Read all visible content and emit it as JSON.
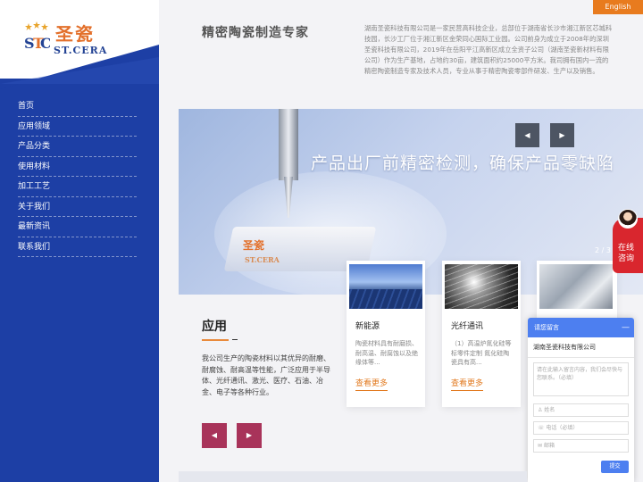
{
  "brand": {
    "name_cn": "圣瓷",
    "name_en": "ST.CERA",
    "mark": "STC"
  },
  "header": {
    "english_label": "English"
  },
  "nav": [
    {
      "label": "首页"
    },
    {
      "label": "应用领域"
    },
    {
      "label": "产品分类"
    },
    {
      "label": "使用材料"
    },
    {
      "label": "加工工艺"
    },
    {
      "label": "关于我们"
    },
    {
      "label": "最新资讯"
    },
    {
      "label": "联系我们"
    }
  ],
  "intro": {
    "title": "精密陶瓷制造专家",
    "text": "湖南圣瓷科技有限公司是一家民营高科技企业，总部位于湖南省长沙市湘江新区芯城科技园，长沙工厂位于湘江新区金荣同心国际工业园。公司前身为成立于2008年的深圳圣瓷科技有限公司，2019年在岳阳平江高新区成立全资子公司（湖南圣瓷新材料有限公司）作为生产基地，占地约30亩，建筑面积约25000平方米。我司拥有国内一流的精密陶瓷制造专家及技术人员，专业从事于精密陶瓷零部件研发、生产以及销售。"
  },
  "banner": {
    "slogan": "产品出厂前精密检测，确保产品零缺陷",
    "part_logo_cn": "圣瓷",
    "part_logo_en": "ST.CERA",
    "counter": "2 / 3",
    "prev_glyph": "◀",
    "next_glyph": "▶"
  },
  "application": {
    "title": "应用",
    "dash": "–",
    "desc": "我公司生产的陶瓷材料以其优异的耐磨、耐腐蚀、耐高温等性能，广泛应用于半导体、光纤通讯、激光、医疗、石油、冶金、电子等各种行业。",
    "prev_glyph": "◀",
    "next_glyph": "▶",
    "cards": [
      {
        "title": "新能源",
        "desc": "陶瓷材料具有耐磨损、耐高温、耐腐蚀以及绝缘体等...",
        "more": "查看更多"
      },
      {
        "title": "光纤通讯",
        "desc": "（1）高温炉氮化硅等标零件定制 氮化硅陶瓷具有高...",
        "more": "查看更多"
      }
    ]
  },
  "consult": {
    "label_line1": "在线",
    "label_line2": "咨询"
  },
  "message": {
    "header": "请您留言",
    "minimize": "—",
    "company": "湖南圣瓷科技有限公司",
    "content_placeholder": "请在此输入留言内容，我们会尽快与您联系。（必填）",
    "name_placeholder": "姓名",
    "phone_placeholder": "电话（必填）",
    "email_placeholder": "邮箱",
    "submit": "提交"
  },
  "colors": {
    "sidebar": "#1d3fa5",
    "accent_orange": "#e87b1e",
    "nav_button": "#a8335a",
    "consult_red": "#d9262e",
    "message_blue": "#4d7ff0"
  }
}
